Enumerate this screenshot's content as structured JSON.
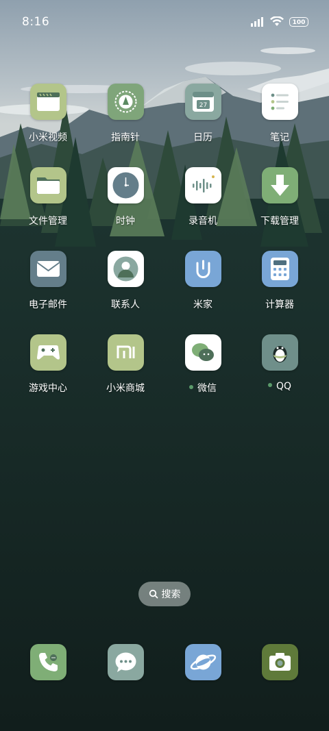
{
  "status_bar": {
    "time": "8:16",
    "battery": "100",
    "icons": [
      "signal-icon",
      "wifi-icon",
      "battery-icon"
    ]
  },
  "apps": [
    {
      "label": "小米视频",
      "icon": "video-player-icon",
      "color": "#b3c58a"
    },
    {
      "label": "指南针",
      "icon": "compass-icon",
      "color": "#7fa57a"
    },
    {
      "label": "日历",
      "icon": "calendar-icon",
      "color": "#8aa8a0",
      "date": "27"
    },
    {
      "label": "笔记",
      "icon": "notes-icon",
      "color": "#ffffff"
    },
    {
      "label": "文件管理",
      "icon": "folder-icon",
      "color": "#b3c58a"
    },
    {
      "label": "时钟",
      "icon": "clock-icon",
      "color": "#ffffff"
    },
    {
      "label": "录音机",
      "icon": "sound-recorder-icon",
      "color": "#ffffff"
    },
    {
      "label": "下载管理",
      "icon": "download-icon",
      "color": "#7fae76"
    },
    {
      "label": "电子邮件",
      "icon": "mail-icon",
      "color": "#647e8a"
    },
    {
      "label": "联系人",
      "icon": "contacts-icon",
      "color": "#ffffff"
    },
    {
      "label": "米家",
      "icon": "mijia-icon",
      "color": "#79a6d6"
    },
    {
      "label": "计算器",
      "icon": "calculator-icon",
      "color": "#79a6d6"
    },
    {
      "label": "游戏中心",
      "icon": "gamepad-icon",
      "color": "#b3c58a"
    },
    {
      "label": "小米商城",
      "icon": "mi-store-icon",
      "color": "#b3c58a"
    },
    {
      "label": "微信",
      "icon": "wechat-icon",
      "color": "#ffffff",
      "new_dot": "#5b9a6a"
    },
    {
      "label": "QQ",
      "icon": "qq-penguin-icon",
      "color": "#6f8f8a",
      "new_dot": "#5b9a6a"
    }
  ],
  "search": {
    "label": "搜索"
  },
  "dock": [
    {
      "icon": "phone-icon",
      "color": "#7fae76"
    },
    {
      "icon": "messages-icon",
      "color": "#8aa8a0"
    },
    {
      "icon": "browser-icon",
      "color": "#79a6d6"
    },
    {
      "icon": "camera-icon",
      "color": "#5f7a3a"
    }
  ]
}
